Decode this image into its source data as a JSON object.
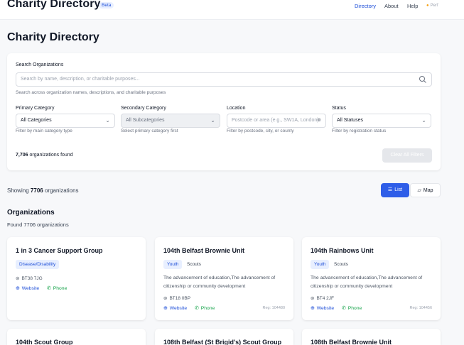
{
  "header": {
    "brand": "Charity Directory",
    "badge": "Beta",
    "nav": [
      "Directory",
      "About",
      "Help"
    ],
    "perf": "Perf"
  },
  "page_title": "Charity Directory",
  "filters": {
    "search_label": "Search Organizations",
    "search_placeholder": "Search by name, description, or charitable purposes...",
    "search_help": "Search across organization names, descriptions, and charitable purposes",
    "primary_label": "Primary Category",
    "primary_value": "All Categories",
    "primary_help": "Filter by main category type",
    "secondary_label": "Secondary Category",
    "secondary_value": "All Subcategories",
    "secondary_help": "Select primary category first",
    "location_label": "Location",
    "location_placeholder": "Postcode or area (e.g., SW1A, London)",
    "location_help": "Filter by postcode, city, or county",
    "status_label": "Status",
    "status_value": "All Statuses",
    "status_help": "Filter by registration status",
    "found_count": "7,706",
    "found_suffix": "organizations found",
    "clear_label": "Clear All Filters"
  },
  "results": {
    "showing_prefix": "Showing",
    "showing_count": "7706",
    "showing_suffix": "organizations",
    "view_list": "List",
    "view_map": "Map",
    "section_title": "Organizations",
    "section_sub": "Found 7706 organizations"
  },
  "cards": [
    {
      "title": "1 in 3 Cancer Support Group",
      "primary_tag": "Disease/Disability",
      "secondary_tag": "",
      "description": "",
      "postcode": "BT38 7JG",
      "website": "Website",
      "phone": "Phone",
      "reg": ""
    },
    {
      "title": "104th Belfast Brownie Unit",
      "primary_tag": "Youth",
      "secondary_tag": "Scouts",
      "description": "The advancement of education,The advancement of citizenship or community development",
      "postcode": "BT18 0BP",
      "website": "Website",
      "phone": "Phone",
      "reg": "Reg: 104480"
    },
    {
      "title": "104th Rainbows Unit",
      "primary_tag": "Youth",
      "secondary_tag": "Scouts",
      "description": "The advancement of education,The advancement of citizenship or community development",
      "postcode": "BT4 2JF",
      "website": "Website",
      "phone": "Phone",
      "reg": "Reg: 104456"
    },
    {
      "title": "104th Scout Group"
    },
    {
      "title": "108th Belfast (St Brigid's) Scout Group"
    },
    {
      "title": "108th Belfast Brownie Unit"
    }
  ],
  "colors": {
    "accent": "#2f5ee8",
    "link": "#1d4ed8",
    "phone": "#16a34a"
  }
}
